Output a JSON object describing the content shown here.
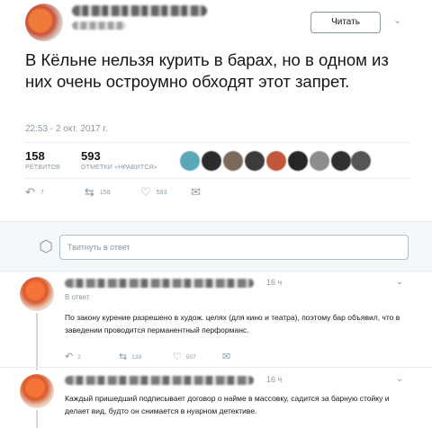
{
  "tweet": {
    "follow_label": "Читать",
    "text": "В Кёльне нельзя курить в барах, но в одном из них  очень остроумно обходят этот запрет.",
    "timestamp": "22:53 - 2 окт. 2017 г.",
    "retweets": "158",
    "retweets_label": "РЕТВИТОВ",
    "likes": "593",
    "likes_label": "ОТМЕТКИ «НРАВИТСЯ»",
    "actions": {
      "reply_count": "7",
      "retweet_count": "158",
      "like_count": "593"
    }
  },
  "reply_box": {
    "placeholder": "Твитнуть в ответ"
  },
  "replies": [
    {
      "time": "16 ч",
      "reply_to_prefix": "В ответ",
      "text": "По закону курение разрешено в худож. целях (для кино и театра), поэтому бар объявил, что в заведении проводится перманентный перформанс.",
      "reply_count": "2",
      "retweet_count": "139",
      "like_count": "507"
    },
    {
      "time": "16 ч",
      "text": "Каждый пришедший подписывает договор о найме в массовку, садится за барную стойку и делает вид, будто он снимается в нуарном детективе."
    }
  ],
  "icons": {
    "reply": "reply-icon",
    "retweet": "retweet-icon",
    "like": "heart-icon",
    "dm": "envelope-icon",
    "more": "chevron-down-icon",
    "reply_avatar": "cube-icon"
  },
  "colors": {
    "muted": "#8899a6",
    "text": "#14171a",
    "divider": "#e6ecf0",
    "reply_bg": "#f5f8fa"
  }
}
